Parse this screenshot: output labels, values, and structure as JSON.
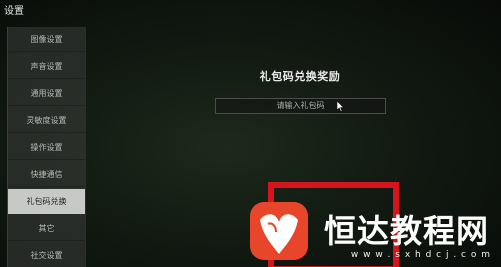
{
  "window": {
    "title": "设置"
  },
  "sidebar": {
    "items": [
      {
        "label": "图像设置"
      },
      {
        "label": "声音设置"
      },
      {
        "label": "通用设置"
      },
      {
        "label": "灵敏度设置"
      },
      {
        "label": "操作设置"
      },
      {
        "label": "快捷通信"
      },
      {
        "label": "礼包码兑换",
        "active": true
      },
      {
        "label": "其它"
      },
      {
        "label": "社交设置"
      }
    ]
  },
  "main": {
    "title": "礼包码兑换奖励",
    "code_input": {
      "placeholder": "请输入礼包码"
    }
  },
  "overlay": {
    "highlight_color": "#d4161c"
  },
  "watermark": {
    "logo_color": "#e8462b",
    "text": "恒达教程网",
    "url": "w w w . s x h d c j . c o m"
  }
}
